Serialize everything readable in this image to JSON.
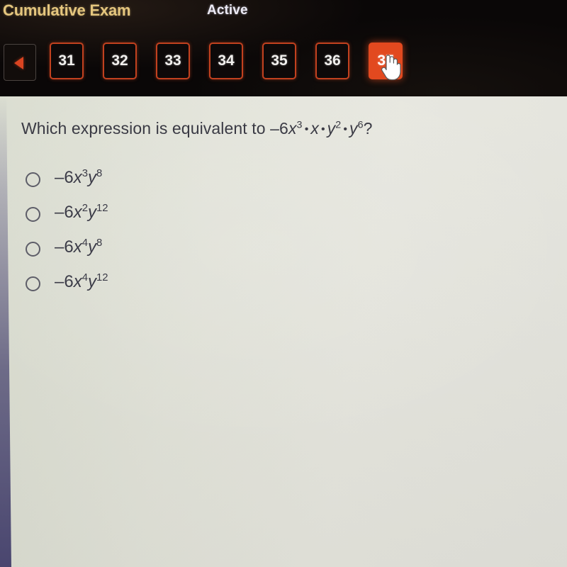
{
  "header": {
    "title": "Cumulative Exam",
    "status": "Active",
    "title_color": "#e5c67e",
    "status_color": "#eceaf5",
    "background_color": "#0a0707"
  },
  "navigation": {
    "prev_button": {
      "icon": "left-triangle-icon",
      "label": ""
    },
    "tabs": [
      {
        "label": "31",
        "active": false
      },
      {
        "label": "32",
        "active": false
      },
      {
        "label": "33",
        "active": false
      },
      {
        "label": "34",
        "active": false
      },
      {
        "label": "35",
        "active": false
      },
      {
        "label": "36",
        "active": false
      },
      {
        "label": "37",
        "active": true
      }
    ],
    "active_tab": "37",
    "tab_border_color": "#c2411f",
    "tab_active_fill": "#e2491f",
    "cursor": "pointer-hand-cursor"
  },
  "content": {
    "background_color": "#dfe2d6",
    "question": {
      "prefix": "Which expression is equivalent to ",
      "coefficient": "–6",
      "base1": "x",
      "exp1": "3",
      "factor2": "x",
      "base3": "y",
      "exp3": "2",
      "base4": "y",
      "exp4": "6",
      "suffix": "?",
      "plain_text": "Which expression is equivalent to –6x³ • x • y² • y⁶?"
    },
    "options": [
      {
        "coefficient": "–6",
        "xbase": "x",
        "xexp": "3",
        "ybase": "y",
        "yexp": "8",
        "plain_text": "–6x³y⁸",
        "selected": false
      },
      {
        "coefficient": "–6",
        "xbase": "x",
        "xexp": "2",
        "ybase": "y",
        "yexp": "12",
        "plain_text": "–6x²y¹²",
        "selected": false
      },
      {
        "coefficient": "–6",
        "xbase": "x",
        "xexp": "4",
        "ybase": "y",
        "yexp": "8",
        "plain_text": "–6x⁴y⁸",
        "selected": false
      },
      {
        "coefficient": "–6",
        "xbase": "x",
        "xexp": "4",
        "ybase": "y",
        "yexp": "12",
        "plain_text": "–6x⁴y¹²",
        "selected": false
      }
    ]
  }
}
